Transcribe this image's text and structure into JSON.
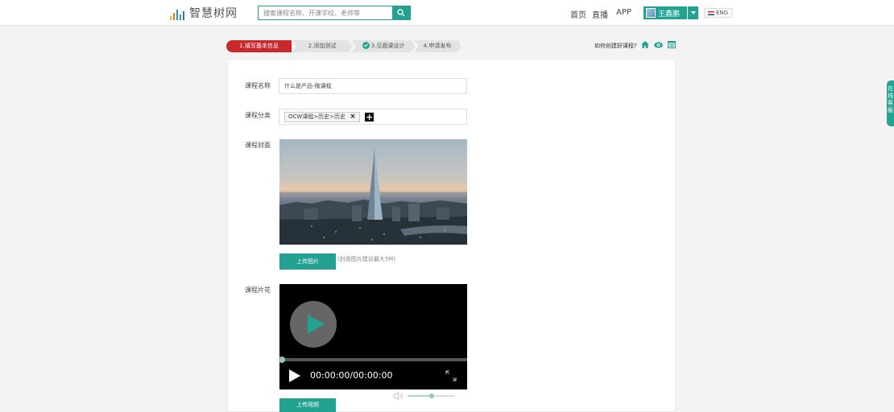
{
  "header": {
    "logo_text": "智慧树网",
    "search": {
      "placeholder": "搜索课程名称、开课学校、老师等"
    },
    "nav": {
      "home": "首页",
      "live": "直播",
      "app": "APP"
    },
    "user": {
      "name": "王鑫鹏"
    },
    "lang": {
      "label": "ENG"
    }
  },
  "steps": [
    {
      "label": "1.填写基本信息",
      "state": "active"
    },
    {
      "label": "2.添加测试",
      "state": "todo"
    },
    {
      "label": "3.见面课设计",
      "state": "done"
    },
    {
      "label": "4.申请发布",
      "state": "todo"
    }
  ],
  "help": {
    "how_to": "如何创建好课程?"
  },
  "form": {
    "name_label": "课程名称",
    "name_value": "什么是产品-微课程",
    "category_label": "课程分类",
    "category_tag": "OCW课程>历史>历史",
    "cover_label": "课程封面",
    "upload_image": "上传图片",
    "cover_hint": "(封面图片建议最大5M)",
    "trailer_label": "课程片花",
    "upload_video": "上传视频"
  },
  "video": {
    "timecode": "00:00:00/00:00:00",
    "progress": 0,
    "volume": 0.5
  },
  "side_tab": {
    "label": "在线客服"
  },
  "colors": {
    "accent": "#23a191",
    "active_step": "#c9282d",
    "step_inactive": "#e3e3e3"
  }
}
